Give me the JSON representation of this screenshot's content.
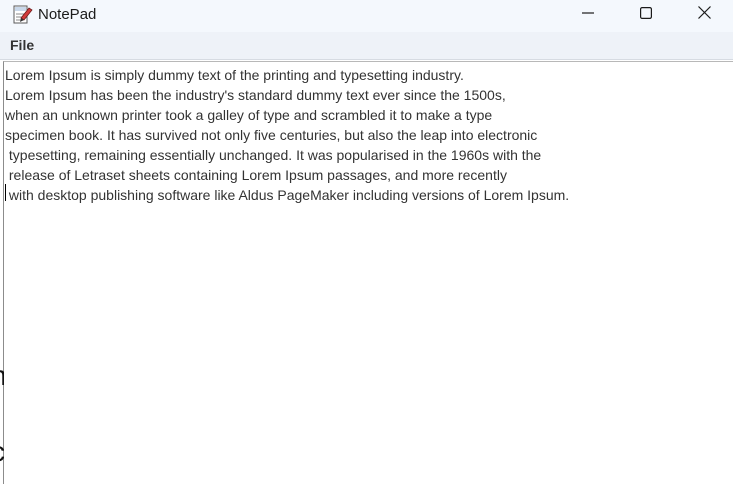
{
  "window": {
    "title": "NotePad",
    "app_icon": "notepad-app-icon",
    "controls": {
      "minimize_icon": "minimize-icon",
      "maximize_icon": "maximize-icon",
      "close_icon": "close-icon"
    }
  },
  "menu": {
    "file_label": "File"
  },
  "editor": {
    "lines": [
      "Lorem Ipsum is simply dummy text of the printing and typesetting industry.",
      "Lorem Ipsum has been the industry's standard dummy text ever since the 1500s,",
      "when an unknown printer took a galley of type and scrambled it to make a type",
      "specimen book. It has survived not only five centuries, but also the leap into electronic",
      " typesetting, remaining essentially unchanged. It was popularised in the 1960s with the",
      " release of Letraset sheets containing Lorem Ipsum passages, and more recently",
      " with desktop publishing software like Aldus PageMaker including versions of Lorem Ipsum."
    ]
  },
  "colors": {
    "titlebar": "#f4f8fd",
    "menubar": "#eef2f8",
    "text": "#333333",
    "close_hover": "#e81123"
  }
}
